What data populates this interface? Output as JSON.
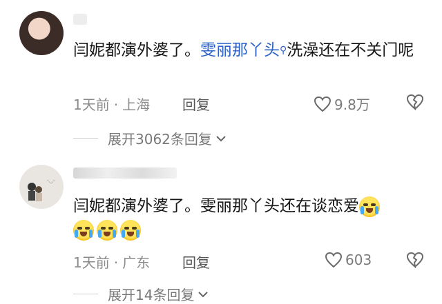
{
  "comments": [
    {
      "text_pre": "闫妮都演外婆了。",
      "link": "雯丽那丫头",
      "text_post": "洗澡还在不关门呢",
      "time": "1天前",
      "location": "上海",
      "reply_label": "回复",
      "likes": "9.8万",
      "expand_label": "展开3062条回复"
    },
    {
      "text": "闫妮都演外婆了。雯丽那丫头还在谈恋爱",
      "time": "1天前",
      "location": "广东",
      "reply_label": "回复",
      "likes": "603",
      "expand_label": "展开14条回复"
    }
  ],
  "icons": {
    "search": "search-icon",
    "heart": "heart-icon",
    "dislike": "broken-heart-icon",
    "chevron": "chevron-down-icon",
    "emoji": "crying-laughing-emoji"
  },
  "colors": {
    "link": "#2d63c8",
    "meta": "#8a8a8a"
  }
}
